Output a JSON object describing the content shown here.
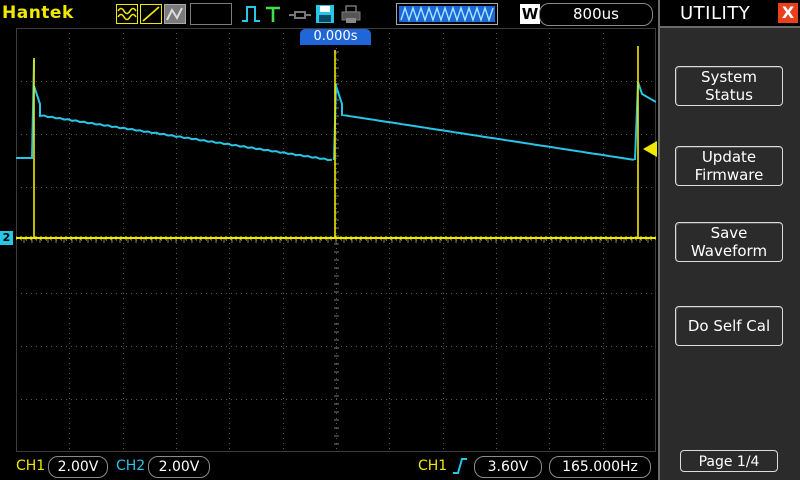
{
  "brand": "Hantek",
  "timebase": "800us",
  "acq_mode_badge": "W",
  "trigger_time": "0.000s",
  "ch2_marker_label": "2",
  "status": {
    "ch1_label": "CH1",
    "ch1_scale": "2.00V",
    "ch2_label": "CH2",
    "ch2_scale": "2.00V",
    "trig_source": "CH1",
    "trig_level": "3.60V",
    "trig_freq": "165.000Hz"
  },
  "menu": {
    "title": "UTILITY",
    "close_label": "X",
    "buttons": [
      {
        "line1": "System",
        "line2": "Status"
      },
      {
        "line1": "Update",
        "line2": "Firmware"
      },
      {
        "line1": "Save",
        "line2": "Waveform"
      },
      {
        "line1": "Do Self Cal",
        "line2": ""
      }
    ],
    "page": "Page 1/4"
  },
  "colors": {
    "ch1": "#f0e800",
    "ch2": "#27c6e6",
    "trigger_pos": "#1f66d8",
    "menu_bg": "#2b2b2b",
    "close_btn": "#e8401c"
  },
  "icons": [
    "mode-wave-icon",
    "slope-icon",
    "acq-icon",
    "run-pulse-icon",
    "trigger-t-icon",
    "probe-icon",
    "save-disk-icon",
    "print-icon",
    "memory-wave-icon"
  ]
}
